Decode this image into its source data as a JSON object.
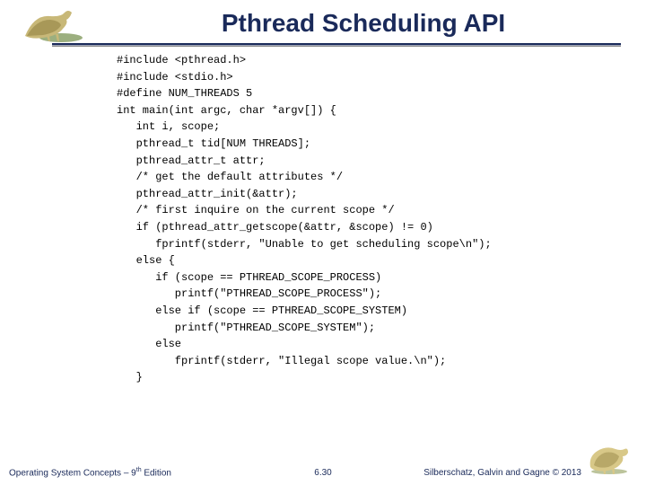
{
  "title": "Pthread Scheduling API",
  "code": "#include <pthread.h>\n#include <stdio.h>\n#define NUM_THREADS 5\nint main(int argc, char *argv[]) {\n   int i, scope;\n   pthread_t tid[NUM THREADS];\n   pthread_attr_t attr;\n   /* get the default attributes */\n   pthread_attr_init(&attr);\n   /* first inquire on the current scope */\n   if (pthread_attr_getscope(&attr, &scope) != 0)\n      fprintf(stderr, \"Unable to get scheduling scope\\n\");\n   else {\n      if (scope == PTHREAD_SCOPE_PROCESS)\n         printf(\"PTHREAD_SCOPE_PROCESS\");\n      else if (scope == PTHREAD_SCOPE_SYSTEM)\n         printf(\"PTHREAD_SCOPE_SYSTEM\");\n      else\n         fprintf(stderr, \"Illegal scope value.\\n\");\n   }",
  "footer": {
    "left_a": "Operating System Concepts – 9",
    "left_b": " Edition",
    "left_sup": "th",
    "center": "6.30",
    "right": "Silberschatz, Galvin and Gagne © 2013"
  },
  "icons": {
    "dino_left": "dinosaur-icon",
    "dino_right": "dinosaur-icon"
  }
}
